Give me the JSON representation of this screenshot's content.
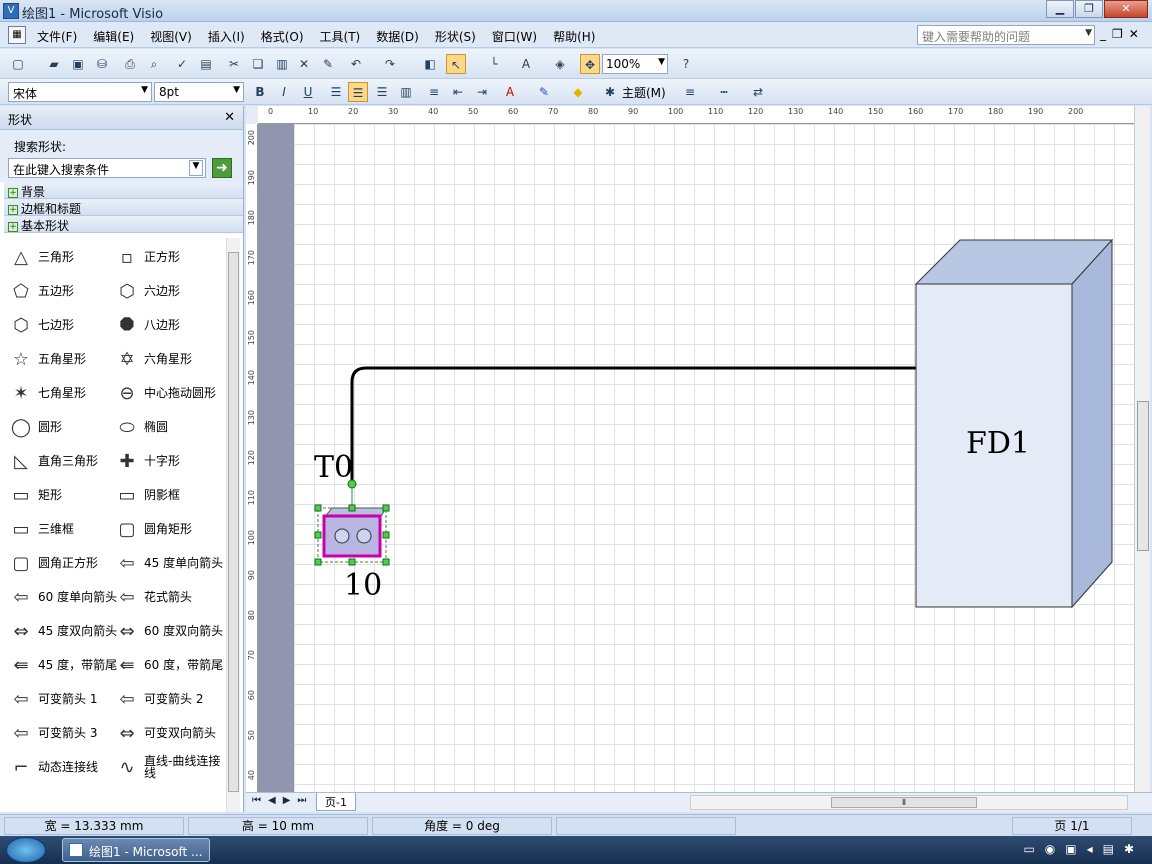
{
  "window": {
    "title": "绘图1 - Microsoft Visio"
  },
  "menu": {
    "items": [
      "文件(F)",
      "编辑(E)",
      "视图(V)",
      "插入(I)",
      "格式(O)",
      "工具(T)",
      "数据(D)",
      "形状(S)",
      "窗口(W)",
      "帮助(H)"
    ],
    "help_placeholder": "键入需要帮助的问题"
  },
  "toolbar": {
    "zoom": "100%",
    "font_name": "宋体",
    "font_size": "8pt",
    "theme_label": "主题(M)"
  },
  "shapes_pane": {
    "title": "形状",
    "search_label": "搜索形状:",
    "search_placeholder": "在此键入搜索条件",
    "stencils": [
      "背景",
      "边框和标题",
      "基本形状"
    ],
    "shapes": [
      {
        "label": "三角形",
        "icon": "triangle-icon"
      },
      {
        "label": "正方形",
        "icon": "square-icon"
      },
      {
        "label": "五边形",
        "icon": "pentagon-icon"
      },
      {
        "label": "六边形",
        "icon": "hexagon-icon"
      },
      {
        "label": "七边形",
        "icon": "heptagon-icon"
      },
      {
        "label": "八边形",
        "icon": "octagon-icon"
      },
      {
        "label": "五角星形",
        "icon": "star5-icon"
      },
      {
        "label": "六角星形",
        "icon": "star6-icon"
      },
      {
        "label": "七角星形",
        "icon": "star7-icon"
      },
      {
        "label": "中心拖动圆形",
        "icon": "center-circle-icon"
      },
      {
        "label": "圆形",
        "icon": "circle-icon"
      },
      {
        "label": "椭圆",
        "icon": "ellipse-icon"
      },
      {
        "label": "直角三角形",
        "icon": "right-triangle-icon"
      },
      {
        "label": "十字形",
        "icon": "cross-icon"
      },
      {
        "label": "矩形",
        "icon": "rectangle-icon"
      },
      {
        "label": "阴影框",
        "icon": "shadow-box-icon"
      },
      {
        "label": "三维框",
        "icon": "3d-box-icon"
      },
      {
        "label": "圆角矩形",
        "icon": "rounded-rect-icon"
      },
      {
        "label": "圆角正方形",
        "icon": "rounded-square-icon"
      },
      {
        "label": "45 度单向箭头",
        "icon": "arrow-45-icon"
      },
      {
        "label": "60 度单向箭头",
        "icon": "arrow-60-icon"
      },
      {
        "label": "花式箭头",
        "icon": "fancy-arrow-icon"
      },
      {
        "label": "45 度双向箭头",
        "icon": "double-arrow-45-icon"
      },
      {
        "label": "60 度双向箭头",
        "icon": "double-arrow-60-icon"
      },
      {
        "label": "45 度，带箭尾",
        "icon": "tail-arrow-45-icon"
      },
      {
        "label": "60 度，带箭尾",
        "icon": "tail-arrow-60-icon"
      },
      {
        "label": "可变箭头 1",
        "icon": "variable-arrow-1-icon"
      },
      {
        "label": "可变箭头 2",
        "icon": "variable-arrow-2-icon"
      },
      {
        "label": "可变箭头 3",
        "icon": "variable-arrow-3-icon"
      },
      {
        "label": "可变双向箭头",
        "icon": "variable-double-arrow-icon"
      },
      {
        "label": "动态连接线",
        "icon": "dynamic-connector-icon"
      },
      {
        "label": "直线-曲线连接线",
        "icon": "line-curve-connector-icon"
      }
    ]
  },
  "rulers": {
    "horizontal": [
      "0",
      "10",
      "20",
      "30",
      "40",
      "50",
      "60",
      "70",
      "80",
      "90",
      "100",
      "110",
      "120",
      "130",
      "140",
      "150",
      "160",
      "170",
      "180",
      "190",
      "200"
    ],
    "vertical": [
      "200",
      "190",
      "180",
      "170",
      "160",
      "150",
      "140",
      "130",
      "120",
      "110",
      "100",
      "90",
      "80",
      "70",
      "60",
      "50",
      "40"
    ]
  },
  "canvas": {
    "label_t0": "T0",
    "label_10": "10",
    "label_fd1": "FD1"
  },
  "pages": {
    "tab": "页-1"
  },
  "status": {
    "width": "宽 = 13.333 mm",
    "height": "高 = 10 mm",
    "angle": "角度 = 0 deg",
    "page": "页 1/1"
  },
  "taskbar": {
    "task": "绘图1 - Microsoft ..."
  }
}
